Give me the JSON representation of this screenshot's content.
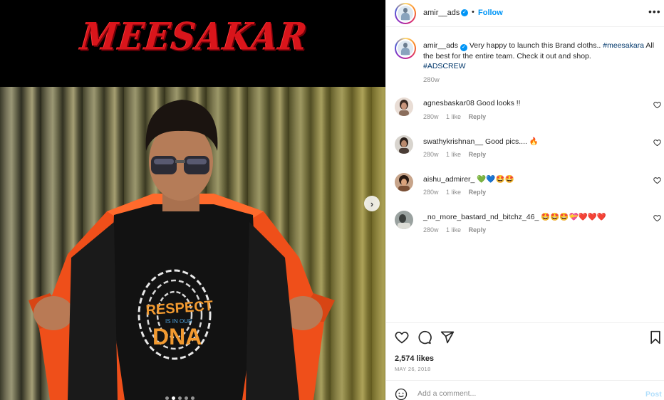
{
  "media": {
    "brand_text": "MEESAKAR",
    "shirt_text_top": "RESPECT",
    "shirt_text_mid": "IS IN OUR",
    "shirt_text_bottom": "DNA",
    "next_icon": "chevron-right-icon",
    "carousel_total": 5,
    "carousel_active": 2
  },
  "header": {
    "username": "amir__ads",
    "verified_icon": "verified-badge-icon",
    "separator": "•",
    "follow_label": "Follow",
    "more_icon": "more-options-icon"
  },
  "caption": {
    "username": "amir__ads",
    "text_before": " Very happy to launch this Brand cloths.. ",
    "hashtag1": "#meesakara",
    "text_after": " All the best for the entire team. Check it out and shop.",
    "hashtag2": "#ADSCREW",
    "time": "280w"
  },
  "comments": [
    {
      "username": "agnesbaskar08",
      "text": "Good looks !!",
      "emoji": "",
      "time": "280w",
      "likes": "1 like",
      "reply": "Reply"
    },
    {
      "username": "swathykrishnan__",
      "text": "Good pics....",
      "emoji": "🔥",
      "time": "280w",
      "likes": "1 like",
      "reply": "Reply"
    },
    {
      "username": "aishu_admirer_",
      "text": "",
      "emoji": "💚💙🤩🤩",
      "time": "280w",
      "likes": "1 like",
      "reply": "Reply"
    },
    {
      "username": "_no_more_bastard_nd_bitchz_46_",
      "text": "",
      "emoji": "🤩🤩🤩💝❤️❤️❤️",
      "time": "280w",
      "likes": "1 like",
      "reply": "Reply"
    }
  ],
  "actions": {
    "like_icon": "heart-icon",
    "comment_icon": "comment-icon",
    "share_icon": "share-icon",
    "save_icon": "bookmark-icon"
  },
  "likes": "2,574 likes",
  "date": "MAY 26, 2018",
  "add_comment": {
    "emoji_icon": "emoji-icon",
    "placeholder": "Add a comment...",
    "post_label": "Post"
  },
  "colors": {
    "link_blue": "#0095f6",
    "hashtag": "#00376b",
    "brand_red": "#d9151b",
    "jacket_orange": "#f2531c"
  }
}
